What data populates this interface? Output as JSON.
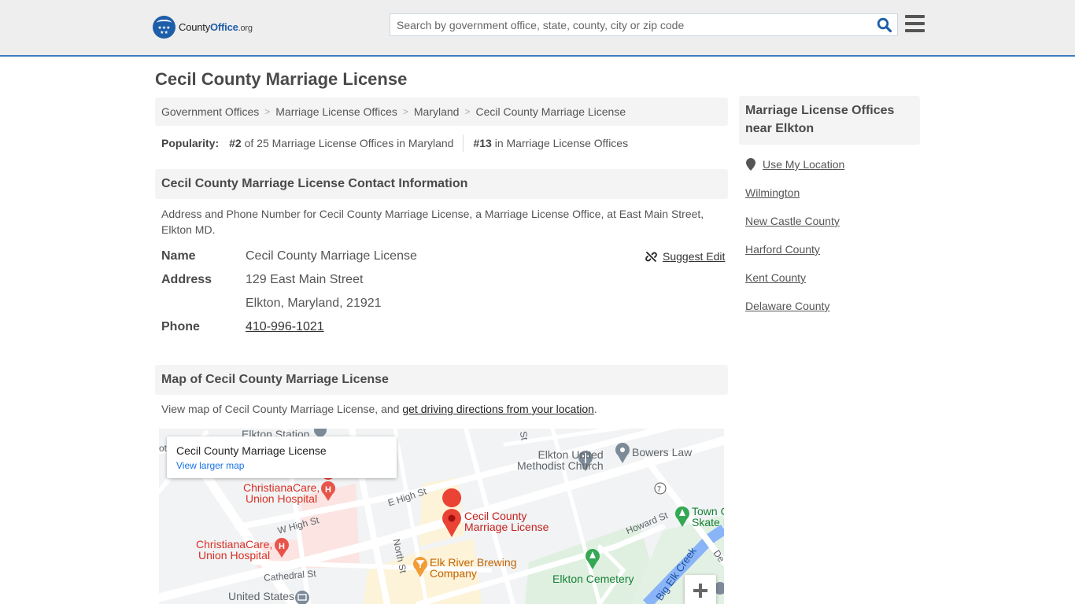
{
  "header": {
    "logo": {
      "county": "County",
      "office": "Office",
      "org": ".org"
    },
    "search_placeholder": "Search by government office, state, county, city or zip code",
    "colors": {
      "brand": "#1e5ea8",
      "accent_line": "#3b7cbf"
    }
  },
  "page_title": "Cecil County Marriage License",
  "breadcrumb": [
    {
      "label": "Government Offices"
    },
    {
      "label": "Marriage License Offices"
    },
    {
      "label": "Maryland"
    },
    {
      "label": "Cecil County Marriage License"
    }
  ],
  "breadcrumb_separator": ">",
  "popularity": {
    "label": "Popularity:",
    "state_rank": "#2",
    "state_text": "of 25 Marriage License Offices in Maryland",
    "national_rank": "#13",
    "national_text": "in Marriage License Offices"
  },
  "contact": {
    "heading": "Cecil County Marriage License Contact Information",
    "description": "Address and Phone Number for Cecil County Marriage License, a Marriage License Office, at East Main Street, Elkton MD.",
    "suggest_edit": "Suggest Edit",
    "fields": {
      "name_label": "Name",
      "name_value": "Cecil County Marriage License",
      "address_label": "Address",
      "address_line1": "129 East Main Street",
      "address_line2": "Elkton, Maryland, 21921",
      "phone_label": "Phone",
      "phone_value": "410-996-1021"
    }
  },
  "map_section": {
    "heading": "Map of Cecil County Marriage License",
    "desc_prefix": "View map of Cecil County Marriage License, and ",
    "desc_link": "get driving directions from your location",
    "desc_suffix": ".",
    "card_title": "Cecil County Marriage License",
    "card_link": "View larger map",
    "labels": {
      "elkton_station": "Elkton Station",
      "ot": "ot",
      "hospital1_l1": "ChristianaCare,",
      "hospital1_l2": "Union Hospital",
      "hospital2_l1": "ChristianaCare,",
      "hospital2_l2": "Union Hospital",
      "w_high": "W High St",
      "e_high": "E High St",
      "cathedral": "Cathedral St",
      "north_st": "North St",
      "usps_l1": "United States",
      "church_l1": "Elkton United",
      "church_l2": "Methodist Church",
      "bowers": "Bowers Law",
      "route": "7",
      "marker_l1": "Cecil County",
      "marker_l2": "Marriage License",
      "brewing_l1": "Elk River Brewing",
      "brewing_l2": "Company",
      "howard": "Howard St",
      "town_l1": "Town C",
      "town_l2": "Skate P",
      "cemetery": "Elkton Cemetery",
      "creek": "Big Elk Creek",
      "st": "St",
      "de": "De"
    }
  },
  "sidebar": {
    "heading": "Marriage License Offices near Elkton",
    "use_location": "Use My Location",
    "links": [
      "Wilmington",
      "New Castle County",
      "Harford County",
      "Kent County",
      "Delaware County"
    ]
  }
}
